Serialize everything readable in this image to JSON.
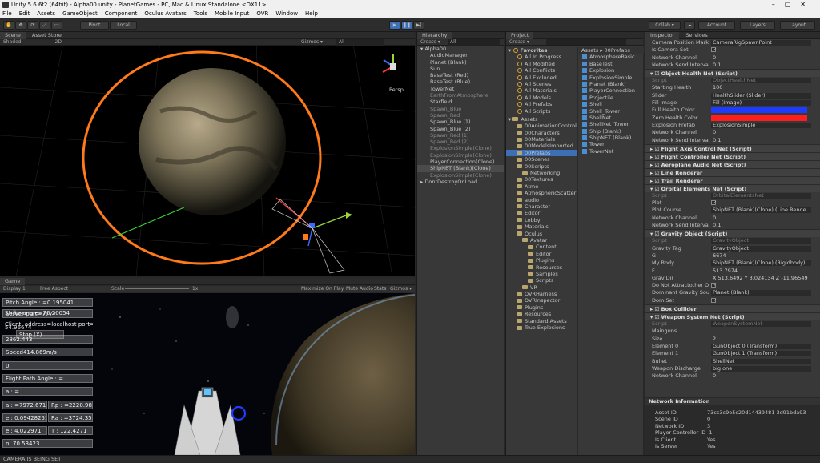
{
  "window": {
    "title": "Unity 5.6.6f2 (64bit) - Alpha00.unity - PlanetGames - PC, Mac & Linux Standalone <DX11>"
  },
  "menu": [
    "File",
    "Edit",
    "Assets",
    "GameObject",
    "Component",
    "Oculus Avatars",
    "Tools",
    "Mobile Input",
    "OVR",
    "Window",
    "Help"
  ],
  "toolbar": {
    "pivot": "Pivot",
    "local": "Local",
    "collab": "Collab ▾",
    "account": "Account",
    "layers": "Layers",
    "layout": "Layout"
  },
  "scene": {
    "tab_scene": "Scene",
    "tab_asset_store": "Asset Store",
    "shading": "Shaded",
    "mode": "2D",
    "gizmos": "Gizmos ▾",
    "search": "All",
    "persp": "Persp"
  },
  "game": {
    "tab": "Game",
    "display": "Display 1",
    "aspect": "Free Aspect",
    "scale_label": "Scale",
    "scale_value": "1x",
    "maximize": "Maximize On Play",
    "mute": "Mute Audio",
    "stats": "Stats",
    "gizmos": "Gizmos ▾",
    "hud": {
      "pitch": "Pitch Angle : =0.195041",
      "server": "Server port=7777",
      "overlay1": "Strike angle=70.20054",
      "client": "Client: address=localhost port=7777",
      "overlay2": "54.96674",
      "overlay3": "Stop (X)",
      "b5": "2862.443",
      "speed": "Speed414.869m/s",
      "b7": "0",
      "flight_path": "Flight Path Angle : =",
      "b9": "a : =",
      "a": "a : =7972.671",
      "rp": "Rp : =2220.987",
      "e": "e : 0.09428255",
      "ra": "Ra : =3724.354",
      "e2": "e : 4.022971",
      "t": "T : 122.4271",
      "n": "n: 70.53423"
    }
  },
  "hierarchy": {
    "tab": "Hierarchy",
    "create": "Create ▾",
    "search": "All",
    "root": "Alpha00",
    "items": [
      {
        "name": "AudioManager",
        "dim": false
      },
      {
        "name": "Planet (Blank)",
        "dim": false
      },
      {
        "name": "Sun",
        "dim": false
      },
      {
        "name": "BaseTest (Red)",
        "dim": false
      },
      {
        "name": "BaseTest (Blue)",
        "dim": false
      },
      {
        "name": "TowerNet",
        "dim": false
      },
      {
        "name": "EarthFromAtmosphere",
        "dim": true
      },
      {
        "name": "Starfield",
        "dim": false
      },
      {
        "name": "Spawn_Blue",
        "dim": true
      },
      {
        "name": "Spawn_Red",
        "dim": true
      },
      {
        "name": "Spawn_Blue (1)",
        "dim": false
      },
      {
        "name": "Spawn_Blue (2)",
        "dim": false
      },
      {
        "name": "Spawn_Red (1)",
        "dim": true
      },
      {
        "name": "Spawn_Red (2)",
        "dim": true
      },
      {
        "name": "ExplosionSimple(Clone)",
        "dim": true
      },
      {
        "name": "ExplosionSimple(Clone)",
        "dim": true
      },
      {
        "name": "PlayerConnection(Clone)",
        "dim": false
      },
      {
        "name": "ShipNET (Blank)(Clone)",
        "dim": false,
        "sel": true
      },
      {
        "name": "ExplosionSimple(Clone)",
        "dim": true
      }
    ],
    "dont_destroy": "DontDestroyOnLoad"
  },
  "project": {
    "tab": "Project",
    "create": "Create ▾",
    "favorites_label": "Favorites",
    "favorites": [
      "All In Progress",
      "All Modified",
      "All Conflicts",
      "All Excluded",
      "All Scenes",
      "All Materials",
      "All Models",
      "All Prefabs",
      "All Scripts"
    ],
    "assets_label": "Assets",
    "folders": [
      {
        "name": "00AnimationControllers",
        "indent": 1
      },
      {
        "name": "00Characters",
        "indent": 1
      },
      {
        "name": "00Materials",
        "indent": 1
      },
      {
        "name": "00ModelsImported",
        "indent": 1
      },
      {
        "name": "00Prefabs",
        "indent": 1,
        "sel": true
      },
      {
        "name": "00Scenes",
        "indent": 1
      },
      {
        "name": "00Scripts",
        "indent": 1
      },
      {
        "name": "Networking",
        "indent": 2
      },
      {
        "name": "00Textures",
        "indent": 1
      },
      {
        "name": "Atmo",
        "indent": 1
      },
      {
        "name": "AtmosphericScatteringOpt",
        "indent": 1
      },
      {
        "name": "audio",
        "indent": 1
      },
      {
        "name": "Character",
        "indent": 1
      },
      {
        "name": "Editor",
        "indent": 1
      },
      {
        "name": "Lobby",
        "indent": 1
      },
      {
        "name": "Materials",
        "indent": 1
      },
      {
        "name": "Oculus",
        "indent": 1
      },
      {
        "name": "Avatar",
        "indent": 2
      },
      {
        "name": "Content",
        "indent": 3
      },
      {
        "name": "Editor",
        "indent": 3
      },
      {
        "name": "Plugins",
        "indent": 3
      },
      {
        "name": "Resources",
        "indent": 3
      },
      {
        "name": "Samples",
        "indent": 3
      },
      {
        "name": "Scripts",
        "indent": 3
      },
      {
        "name": "VR",
        "indent": 2
      },
      {
        "name": "OVRHarness",
        "indent": 1
      },
      {
        "name": "OVRInspector",
        "indent": 1
      },
      {
        "name": "Plugins",
        "indent": 1
      },
      {
        "name": "Resources",
        "indent": 1
      },
      {
        "name": "Standard Assets",
        "indent": 1
      },
      {
        "name": "True Explosions",
        "indent": 1
      }
    ],
    "breadcrumb": "Assets ▸ 00Prefabs",
    "prefabs": [
      "AtmosphereBasic",
      "BaseTest",
      "Explosion",
      "ExplosionSimple",
      "Planet (Blank)",
      "PlayerConnection",
      "Projectile",
      "Shell",
      "Shell_Tower",
      "ShellNet",
      "ShellNet_Tower",
      "Ship (Blank)",
      "ShipNET (Blank)",
      "Tower",
      "TowerNet"
    ]
  },
  "inspector": {
    "tab_inspector": "Inspector",
    "tab_services": "Services",
    "top_rows": [
      {
        "label": "Camera Position Marker",
        "value": "CameraRigSpawnPoint",
        "type": "field"
      },
      {
        "label": "Is Camera Set",
        "value": "",
        "type": "check"
      },
      {
        "label": "Network Channel",
        "value": "0",
        "type": "text"
      },
      {
        "label": "Network Send Interval",
        "value": "0.1",
        "type": "text"
      }
    ],
    "ohn_header": "Object Health Net (Script)",
    "ohn_rows": [
      {
        "label": "Script",
        "value": "ObjectHealthNet",
        "type": "field",
        "dim": true
      },
      {
        "label": "Starting Health",
        "value": "100",
        "type": "text"
      },
      {
        "label": "Slider",
        "value": "HealthSlider (Slider)",
        "type": "field"
      },
      {
        "label": "Fill Image",
        "value": "Fill (Image)",
        "type": "field"
      },
      {
        "label": "Full Health Color",
        "value": "",
        "type": "color_blue"
      },
      {
        "label": "Zero Health Color",
        "value": "",
        "type": "color_red"
      },
      {
        "label": "Explosion Prefab",
        "value": "ExplosionSimple",
        "type": "field"
      },
      {
        "label": "Network Channel",
        "value": "0",
        "type": "text"
      },
      {
        "label": "Network Send Interval",
        "value": "0.1",
        "type": "text"
      }
    ],
    "comp_flight_axis": "Flight Axis Control Net (Script)",
    "comp_flight_ctrl": "Flight Controller Net (Script)",
    "comp_aero": "Aeroplane Audio Net (Script)",
    "comp_line": "Line Renderer",
    "comp_trail": "Trail Renderer",
    "oen_header": "Orbital Elements Net (Script)",
    "oen_rows": [
      {
        "label": "Script",
        "value": "OrbitalElementsNet",
        "type": "field",
        "dim": true
      },
      {
        "label": "Plot",
        "value": "",
        "type": "check"
      },
      {
        "label": "Plot Course",
        "value": "ShipNET (Blank)(Clone) (Line Rende",
        "type": "field"
      },
      {
        "label": "Network Channel",
        "value": "0",
        "type": "text"
      },
      {
        "label": "Network Send Interval",
        "value": "0.1",
        "type": "text"
      }
    ],
    "go_header": "Gravity Object (Script)",
    "go_rows": [
      {
        "label": "Script",
        "value": "GravityObject",
        "type": "field",
        "dim": true
      },
      {
        "label": "Gravity Tag",
        "value": "GravityObject",
        "type": "field"
      },
      {
        "label": "G",
        "value": "6674",
        "type": "text"
      },
      {
        "label": "My Body",
        "value": "ShipNET (Blank)(Clone) (Rigidbody)",
        "type": "field"
      },
      {
        "label": "F",
        "value": "513.7974",
        "type": "text"
      },
      {
        "label": "Grav Dir",
        "value": "X 513.6492  Y 3.024134  Z -11.96549",
        "type": "text"
      },
      {
        "label": "Do Not Attractother Obj",
        "value": "",
        "type": "check"
      },
      {
        "label": "Dominant Gravity Source",
        "value": "Planet (Blank)",
        "type": "field"
      },
      {
        "label": "Dom Set",
        "value": "",
        "type": "check"
      }
    ],
    "comp_box": "Box Collider",
    "wsn_header": "Weapon System Net (Script)",
    "wsn_rows": [
      {
        "label": "Script",
        "value": "WeaponSystemNet",
        "type": "field",
        "dim": true
      },
      {
        "label": "Mainguns",
        "value": "",
        "type": "text"
      },
      {
        "label": "  Size",
        "value": "2",
        "type": "text"
      },
      {
        "label": "  Element 0",
        "value": "GunObject 0 (Transform)",
        "type": "field"
      },
      {
        "label": "  Element 1",
        "value": "GunObject 1 (Transform)",
        "type": "field"
      },
      {
        "label": "Bullet",
        "value": "ShellNet",
        "type": "field"
      },
      {
        "label": "Weapon Discharge",
        "value": "big one",
        "type": "field"
      },
      {
        "label": "Network Channel",
        "value": "0",
        "type": "text"
      }
    ]
  },
  "network_info": {
    "title": "Network Information",
    "rows": [
      {
        "k": "Asset ID",
        "v": "73cc3c9e5c20d14439481 3d91bda93"
      },
      {
        "k": "Scene ID",
        "v": "0"
      },
      {
        "k": "Network ID",
        "v": "3"
      },
      {
        "k": "Player Controller ID",
        "v": "-1"
      },
      {
        "k": "Is Client",
        "v": "Yes"
      },
      {
        "k": "Is Server",
        "v": "Yes"
      }
    ]
  },
  "status": {
    "text": "CAMERA IS BEING SET"
  },
  "colors": {
    "accent": "#3d6fb6",
    "orbit": "#ff7a1a",
    "full_health": "#1e3cff",
    "zero_health": "#ff1e1e"
  }
}
